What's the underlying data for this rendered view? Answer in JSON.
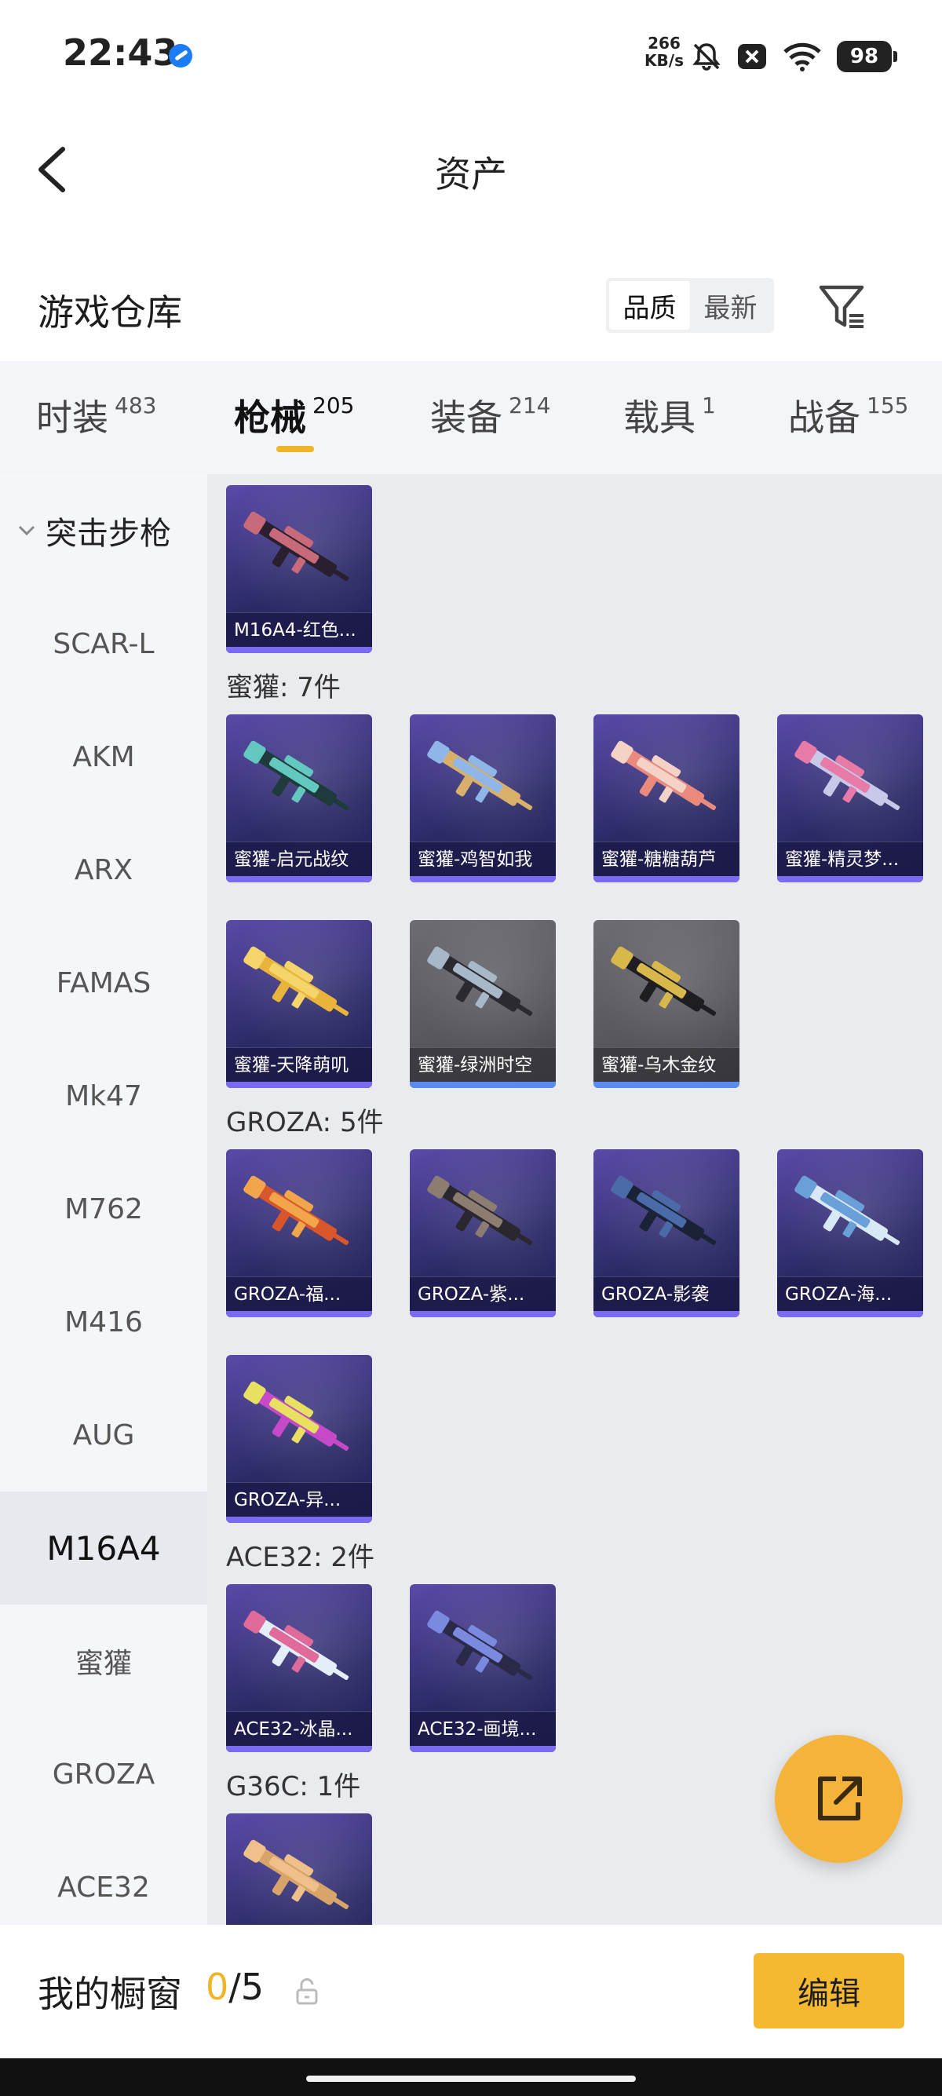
{
  "status_bar": {
    "time": "22:43",
    "speed_value": "266",
    "speed_unit": "KB/s",
    "battery": "98"
  },
  "header": {
    "title": "资产"
  },
  "warehouse": {
    "title": "游戏仓库",
    "sort_options": [
      "品质",
      "最新"
    ],
    "active_sort": "品质"
  },
  "tabs": [
    {
      "label": "时装",
      "count": "483"
    },
    {
      "label": "枪械",
      "count": "205",
      "active": true
    },
    {
      "label": "装备",
      "count": "214"
    },
    {
      "label": "载具",
      "count": "1"
    },
    {
      "label": "战备",
      "count": "155"
    }
  ],
  "sidebar": {
    "group": "突击步枪",
    "items": [
      "SCAR-L",
      "AKM",
      "ARX",
      "FAMAS",
      "Mk47",
      "M762",
      "M416",
      "AUG",
      "M16A4",
      "蜜獾",
      "GROZA",
      "ACE32"
    ],
    "active": "M16A4"
  },
  "sections": [
    {
      "label": "",
      "items": [
        {
          "name": "M16A4-红色...",
          "tier": "purple",
          "gun_colors": [
            "#2a1f2e",
            "#c96a7a"
          ]
        }
      ]
    },
    {
      "label": "蜜獾: 7件",
      "items": [
        {
          "name": "蜜獾-启元战纹",
          "tier": "purple",
          "gun_colors": [
            "#1f3a3a",
            "#63c9c0"
          ]
        },
        {
          "name": "蜜獾-鸡智如我",
          "tier": "purple",
          "gun_colors": [
            "#d9b06a",
            "#8fb6e8"
          ]
        },
        {
          "name": "蜜獾-糖糖葫芦",
          "tier": "purple",
          "gun_colors": [
            "#e98a7d",
            "#f4d2c6"
          ]
        },
        {
          "name": "蜜獾-精灵梦...",
          "tier": "purple",
          "gun_colors": [
            "#c8c8e8",
            "#e77aa6"
          ]
        },
        {
          "name": "蜜獾-天降萌叽",
          "tier": "purple",
          "gun_colors": [
            "#e8b53a",
            "#f5d56b"
          ]
        },
        {
          "name": "蜜獾-绿洲时空",
          "tier": "grey",
          "gun_colors": [
            "#2a2a30",
            "#a7b8c8"
          ]
        },
        {
          "name": "蜜獾-乌木金纹",
          "tier": "grey",
          "gun_colors": [
            "#1e1e22",
            "#d8b84a"
          ]
        }
      ]
    },
    {
      "label": "GROZA: 5件",
      "items": [
        {
          "name": "GROZA-福...",
          "tier": "purple",
          "gun_colors": [
            "#d9552a",
            "#f2a54a"
          ]
        },
        {
          "name": "GROZA-紫...",
          "tier": "purple",
          "gun_colors": [
            "#2b2730",
            "#8c7d70"
          ]
        },
        {
          "name": "GROZA-影袭",
          "tier": "purple",
          "gun_colors": [
            "#1a2236",
            "#4a6aa8"
          ]
        },
        {
          "name": "GROZA-海...",
          "tier": "purple",
          "gun_colors": [
            "#d8e8f4",
            "#6aa0d8"
          ]
        },
        {
          "name": "GROZA-异...",
          "tier": "purple",
          "gun_colors": [
            "#c64ac8",
            "#e8e060"
          ]
        }
      ]
    },
    {
      "label": "ACE32: 2件",
      "items": [
        {
          "name": "ACE32-冰晶...",
          "tier": "purple",
          "gun_colors": [
            "#e4eef8",
            "#e06a9a"
          ]
        },
        {
          "name": "ACE32-画境...",
          "tier": "purple",
          "gun_colors": [
            "#2a2a48",
            "#7a8ae0"
          ]
        }
      ]
    },
    {
      "label": "G36C: 1件",
      "items": [
        {
          "name": "",
          "tier": "purple",
          "gun_colors": [
            "#d8a46a",
            "#f0c08a"
          ]
        }
      ]
    }
  ],
  "bottom_bar": {
    "label": "我的橱窗",
    "current": "0",
    "separator": "/",
    "max": "5",
    "edit_label": "编辑"
  },
  "colors": {
    "accent": "#f4b92e",
    "card_purple": "#5a4aa8",
    "card_grey": "#6c6c72"
  }
}
